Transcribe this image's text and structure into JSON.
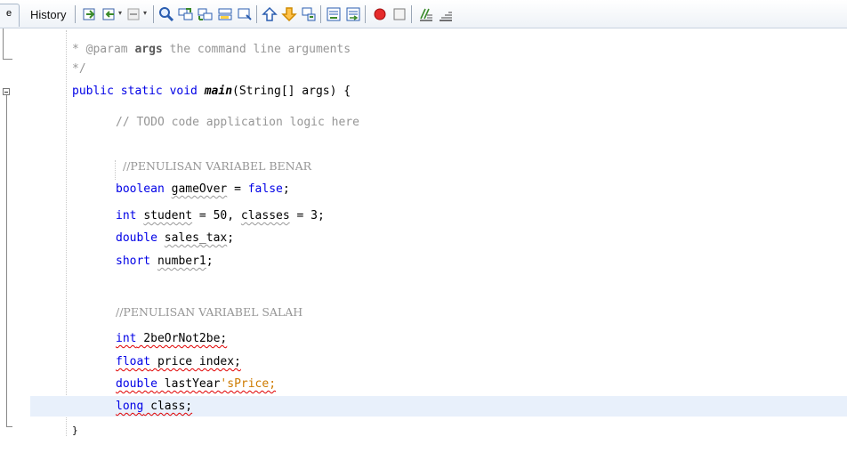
{
  "toolbar": {
    "left_tab_label": "e",
    "history_tab_label": "History",
    "icons": [
      "last-edit-icon",
      "back-icon",
      "forward-icon",
      "find-selection-icon",
      "find-previous-icon",
      "find-next-icon",
      "toggle-highlight-icon",
      "toggle-rect-select-icon",
      "shift-left-icon",
      "shift-right-icon",
      "toggle-bookmark-icon",
      "previous-bookmark-icon",
      "next-bookmark-icon",
      "start-macro-icon",
      "stop-macro-icon",
      "comment-icon",
      "uncomment-icon"
    ]
  },
  "code": {
    "line1": {
      "prefix": "* @param ",
      "param": "args",
      "suffix": " the command line arguments"
    },
    "line2": "*/",
    "line3": {
      "kw": "public static void ",
      "name": "main",
      "rest": "(String[] args) {"
    },
    "line4": "// TODO code application logic here",
    "line6": "//PENULISAN VARIABEL BENAR",
    "line7": {
      "kw": "boolean ",
      "var": "gameOver",
      "mid": " = ",
      "val": "false",
      "end": ";"
    },
    "line8": {
      "kw": "int ",
      "var1": "student",
      "mid1": " = 50, ",
      "var2": "classes",
      "mid2": " = 3;"
    },
    "line9": {
      "kw": "double ",
      "var": "sales_tax",
      "end": ";"
    },
    "line10": {
      "kw": "short ",
      "var": "number1",
      "end": ";"
    },
    "line12": "//PENULISAN VARIABEL SALAH",
    "line13": {
      "kw": "int",
      "rest": " 2beOrNot2be;"
    },
    "line14": {
      "kw": "float",
      "rest": " price index;"
    },
    "line15": {
      "kw": "double",
      "rest1": " lastYear",
      "str": "'sPrice;"
    },
    "line16": {
      "kw": "long",
      "rest": " class;"
    },
    "line17": "}"
  },
  "colors": {
    "keyword": "#0000e6",
    "comment": "#969696",
    "string": "#ce7b00",
    "current_line": "#e8f0fb",
    "error_underline": "#e00000"
  }
}
